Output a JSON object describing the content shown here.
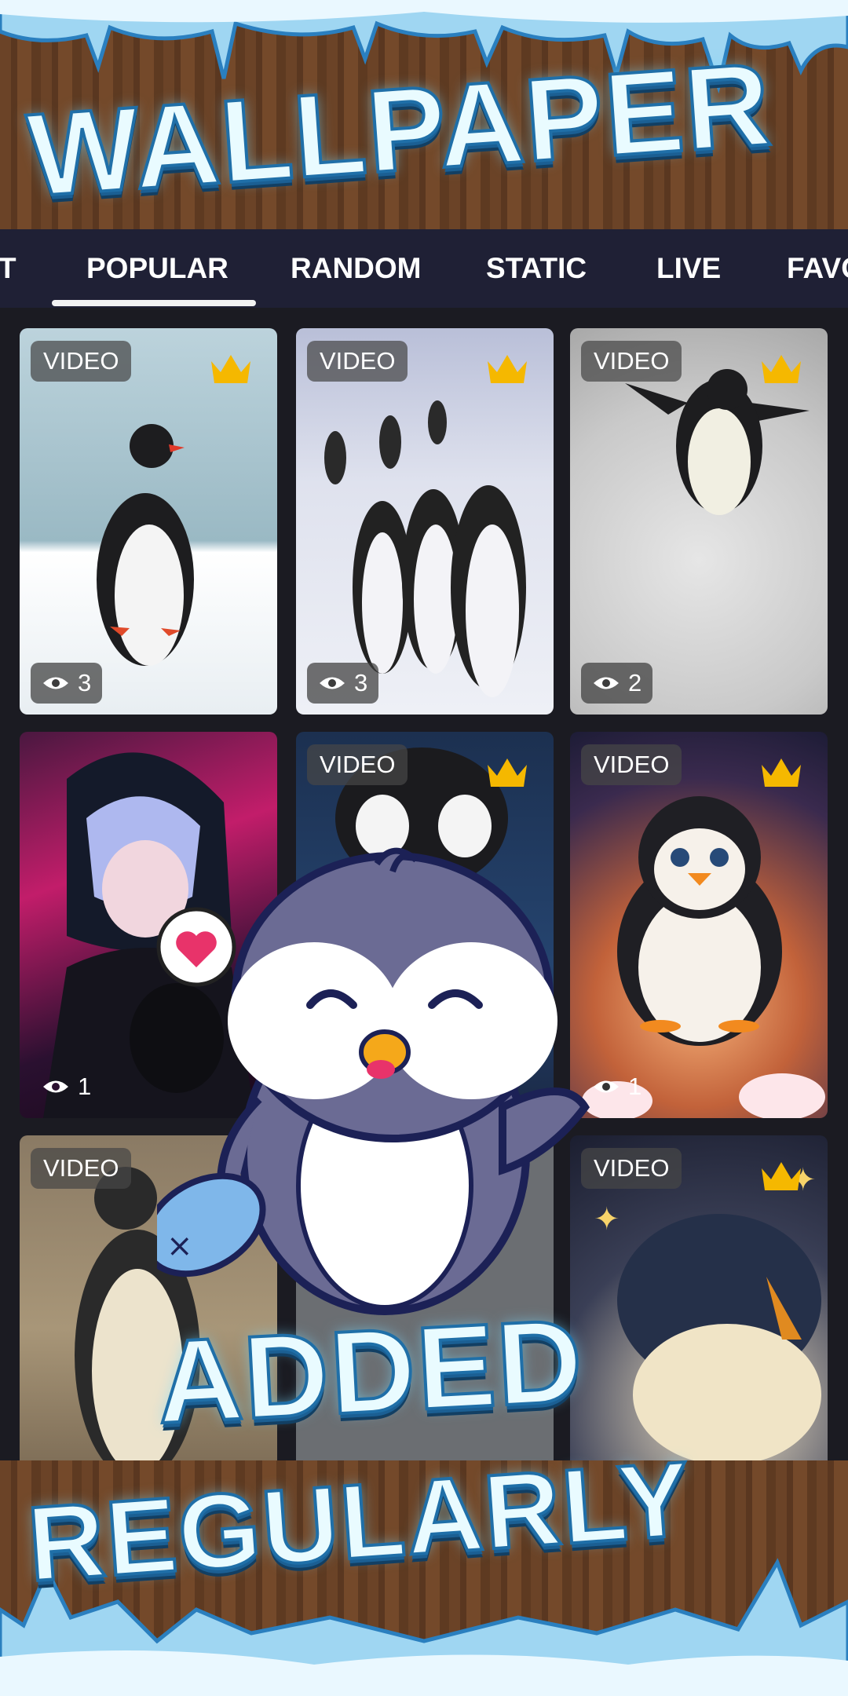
{
  "header": {
    "banner_title": "WALLPAPER"
  },
  "tabs": [
    {
      "label": "T"
    },
    {
      "label": "POPULAR"
    },
    {
      "label": "RANDOM"
    },
    {
      "label": "STATIC"
    },
    {
      "label": "LIVE"
    },
    {
      "label": "FAVO"
    }
  ],
  "active_tab": "POPULAR",
  "cards": [
    {
      "badge": "VIDEO",
      "premium": true,
      "views": "3",
      "subject": "penguin-in-snow"
    },
    {
      "badge": "VIDEO",
      "premium": true,
      "views": "3",
      "subject": "penguins-marching"
    },
    {
      "badge": "VIDEO",
      "premium": true,
      "views": "2",
      "subject": "penguin-walking"
    },
    {
      "badge": "",
      "premium": false,
      "views": "1",
      "subject": "anime-girl-neon"
    },
    {
      "badge": "VIDEO",
      "premium": true,
      "views": "",
      "subject": "penguin-close-up"
    },
    {
      "badge": "VIDEO",
      "premium": true,
      "views": "1",
      "subject": "cute-baby-penguin"
    },
    {
      "badge": "VIDEO",
      "premium": false,
      "views": "",
      "subject": "penguin-rocks"
    },
    {
      "badge": "",
      "premium": false,
      "views": "",
      "subject": "hidden"
    },
    {
      "badge": "VIDEO",
      "premium": true,
      "views": "",
      "subject": "starry-penguin"
    }
  ],
  "footer": {
    "line1": "ADDED",
    "line2": "REGULARLY"
  },
  "colors": {
    "tabbar": "#1f2035",
    "title_fill": "#e9fbff",
    "title_stroke": "#1f6fa8",
    "crown": "#f5b800",
    "heart": "#e8336a"
  }
}
